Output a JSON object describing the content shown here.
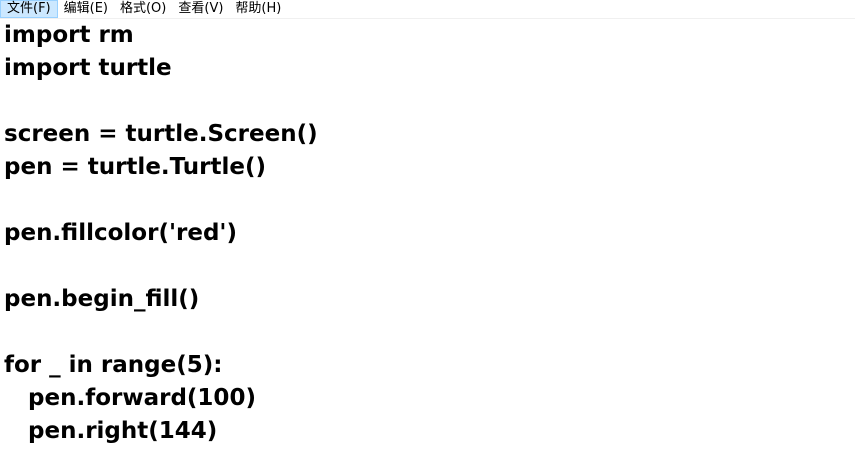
{
  "menubar": {
    "items": [
      {
        "label": "文件(F)",
        "active": true
      },
      {
        "label": "编辑(E)"
      },
      {
        "label": "格式(O)"
      },
      {
        "label": "查看(V)"
      },
      {
        "label": "帮助(H)"
      }
    ]
  },
  "editor": {
    "lines": [
      "import rm",
      "import turtle",
      "",
      "screen = turtle.Screen()",
      "pen = turtle.Turtle()",
      "",
      "pen.fillcolor('red')",
      "",
      "pen.begin_fill()",
      "",
      "for _ in range(5):",
      "   pen.forward(100)",
      "   pen.right(144)"
    ]
  }
}
